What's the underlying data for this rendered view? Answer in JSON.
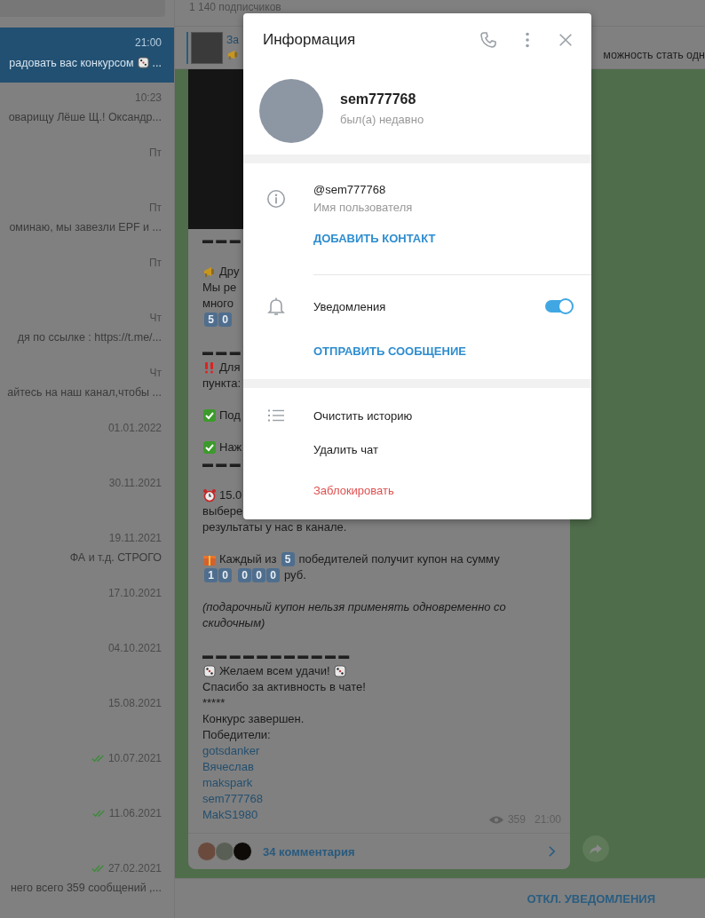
{
  "sidebar": {
    "chats": [
      {
        "time": "21:00",
        "selected": true,
        "read": false,
        "preview": [
          {
            "kind": "text",
            "t": "радовать вас конкурсом"
          },
          {
            "kind": "dice"
          },
          {
            "kind": "text",
            "t": "..."
          }
        ]
      },
      {
        "time": "10:23",
        "selected": false,
        "read": false,
        "preview": [
          {
            "kind": "text",
            "t": "оварищу Лёше Щ.!  Оксандр..."
          }
        ]
      },
      {
        "time": "Пт",
        "selected": false,
        "read": false
      },
      {
        "time": "Пт",
        "selected": false,
        "read": false,
        "preview": [
          {
            "kind": "text",
            "t": "оминаю, мы завезли EPF и ..."
          }
        ]
      },
      {
        "time": "Пт",
        "selected": false,
        "read": false
      },
      {
        "time": "Чт",
        "selected": false,
        "read": false,
        "preview": [
          {
            "kind": "text",
            "t": "дя по ссылке :   https://t.me/..."
          }
        ]
      },
      {
        "time": "Чт",
        "selected": false,
        "read": false,
        "preview": [
          {
            "kind": "text",
            "t": "айтесь на наш канал,чтобы ..."
          }
        ]
      },
      {
        "time": "01.01.2022",
        "selected": false,
        "read": false
      },
      {
        "time": "30.11.2021",
        "selected": false,
        "read": false
      },
      {
        "time": "19.11.2021",
        "selected": false,
        "read": false,
        "preview": [
          {
            "kind": "text",
            "t": "ФА и т.д. СТРОГО"
          }
        ]
      },
      {
        "time": "17.10.2021",
        "selected": false,
        "read": false
      },
      {
        "time": "04.10.2021",
        "selected": false,
        "read": false
      },
      {
        "time": "15.08.2021",
        "selected": false,
        "read": false
      },
      {
        "time": "10.07.2021",
        "selected": false,
        "read": true
      },
      {
        "time": "11.06.2021",
        "selected": false,
        "read": true
      },
      {
        "time": "27.02.2021",
        "selected": false,
        "read": true,
        "preview": [
          {
            "kind": "text",
            "t": "него всего 359 сообщений ,..."
          }
        ]
      }
    ]
  },
  "chat": {
    "subscribers": "1 140 подписчиков",
    "pinned": {
      "title": "За",
      "text": "можность стать одн"
    },
    "message": {
      "lines": [
        {
          "kind": "dashes",
          "parts": [
            {
              "kind": "text",
              "t": "▬ ▬ ▬"
            }
          ]
        },
        {
          "kind": "blank"
        },
        {
          "kind": "plain",
          "parts": [
            {
              "kind": "megaphone"
            },
            {
              "kind": "text",
              "t": "Дру"
            }
          ]
        },
        {
          "kind": "plain",
          "parts": [
            {
              "kind": "text",
              "t": "Мы ре"
            }
          ]
        },
        {
          "kind": "plain",
          "parts": [
            {
              "kind": "text",
              "t": "много"
            }
          ]
        },
        {
          "kind": "plain",
          "parts": [
            {
              "kind": "keys",
              "keys": [
                "5",
                "0"
              ]
            }
          ]
        },
        {
          "kind": "blank"
        },
        {
          "kind": "dashes",
          "parts": [
            {
              "kind": "text",
              "t": "▬ ▬ ▬"
            }
          ]
        },
        {
          "kind": "plain",
          "parts": [
            {
              "kind": "bangbang"
            },
            {
              "kind": "text",
              "t": "Для"
            }
          ]
        },
        {
          "kind": "plain",
          "parts": [
            {
              "kind": "text",
              "t": "пункта:"
            }
          ]
        },
        {
          "kind": "blank"
        },
        {
          "kind": "plain",
          "parts": [
            {
              "kind": "check"
            },
            {
              "kind": "text",
              "t": "Под"
            }
          ]
        },
        {
          "kind": "blank"
        },
        {
          "kind": "plain",
          "parts": [
            {
              "kind": "check"
            },
            {
              "kind": "text",
              "t": "Наж"
            }
          ]
        },
        {
          "kind": "dashes",
          "parts": [
            {
              "kind": "text",
              "t": "▬ ▬ ▬"
            }
          ]
        },
        {
          "kind": "blank"
        },
        {
          "kind": "plain",
          "parts": [
            {
              "kind": "alarm"
            },
            {
              "kind": "text",
              "t": "15.0"
            }
          ]
        },
        {
          "kind": "plain",
          "parts": [
            {
              "kind": "text",
              "t": "выбере"
            }
          ]
        },
        {
          "kind": "plain",
          "parts": [
            {
              "kind": "text",
              "t": "результаты у нас в канале."
            }
          ]
        },
        {
          "kind": "blank"
        },
        {
          "kind": "plain",
          "parts": [
            {
              "kind": "gift"
            },
            {
              "kind": "text",
              "t": "Каждый из"
            },
            {
              "kind": "keys",
              "keys": [
                "5"
              ]
            },
            {
              "kind": "text",
              "t": "победителей получит купон на сумму"
            }
          ]
        },
        {
          "kind": "plain",
          "parts": [
            {
              "kind": "keys",
              "keys": [
                "1",
                "0"
              ]
            },
            {
              "kind": "keys",
              "keys": [
                "0",
                "0",
                "0"
              ]
            },
            {
              "kind": "text",
              "t": "руб."
            }
          ]
        },
        {
          "kind": "blank"
        },
        {
          "kind": "italic",
          "parts": [
            {
              "kind": "text",
              "t": "(подарочный купон нельзя применять одновременно со"
            }
          ]
        },
        {
          "kind": "italic",
          "parts": [
            {
              "kind": "text",
              "t": "скидочным)"
            }
          ]
        },
        {
          "kind": "blank"
        },
        {
          "kind": "dashes",
          "parts": [
            {
              "kind": "text",
              "t": "▬ ▬ ▬ ▬ ▬ ▬ ▬ ▬ ▬ ▬ ▬"
            }
          ]
        },
        {
          "kind": "plain",
          "parts": [
            {
              "kind": "dice"
            },
            {
              "kind": "text",
              "t": "Желаем всем удачи!"
            },
            {
              "kind": "dice"
            }
          ]
        },
        {
          "kind": "plain",
          "parts": [
            {
              "kind": "text",
              "t": "Спасибо за активность в чате!"
            }
          ]
        },
        {
          "kind": "plain",
          "parts": [
            {
              "kind": "text",
              "t": "*****"
            }
          ]
        },
        {
          "kind": "plain",
          "parts": [
            {
              "kind": "text",
              "t": "Конкурс завершен."
            }
          ]
        },
        {
          "kind": "plain",
          "parts": [
            {
              "kind": "text",
              "t": " Победители:"
            }
          ]
        },
        {
          "kind": "link",
          "parts": [
            {
              "kind": "text",
              "t": "gotsdanker"
            }
          ]
        },
        {
          "kind": "link",
          "parts": [
            {
              "kind": "text",
              "t": "Вячеслав"
            }
          ]
        },
        {
          "kind": "link",
          "parts": [
            {
              "kind": "text",
              "t": "makspark"
            }
          ]
        },
        {
          "kind": "link",
          "parts": [
            {
              "kind": "text",
              "t": "sem777768"
            }
          ]
        },
        {
          "kind": "link",
          "parts": [
            {
              "kind": "text",
              "t": "MakS1980"
            }
          ]
        }
      ],
      "views": "359",
      "time": "21:00",
      "comments": "34 комментария"
    },
    "mute_button": "ОТКЛ. УВЕДОМЛЕНИЯ"
  },
  "info_dialog": {
    "title": "Информация",
    "profile": {
      "name": "sem777768",
      "status": "был(а) недавно"
    },
    "username": {
      "value": "@sem777768",
      "label": "Имя пользователя"
    },
    "add_contact": "ДОБАВИТЬ КОНТАКТ",
    "notifications": {
      "label": "Уведомления",
      "on": true
    },
    "send_message": "ОТПРАВИТЬ СООБЩЕНИЕ",
    "actions": [
      {
        "label": "Очистить историю",
        "kind": "normal"
      },
      {
        "label": "Удалить чат",
        "kind": "normal"
      },
      {
        "label": "Заблокировать",
        "kind": "danger"
      }
    ]
  }
}
